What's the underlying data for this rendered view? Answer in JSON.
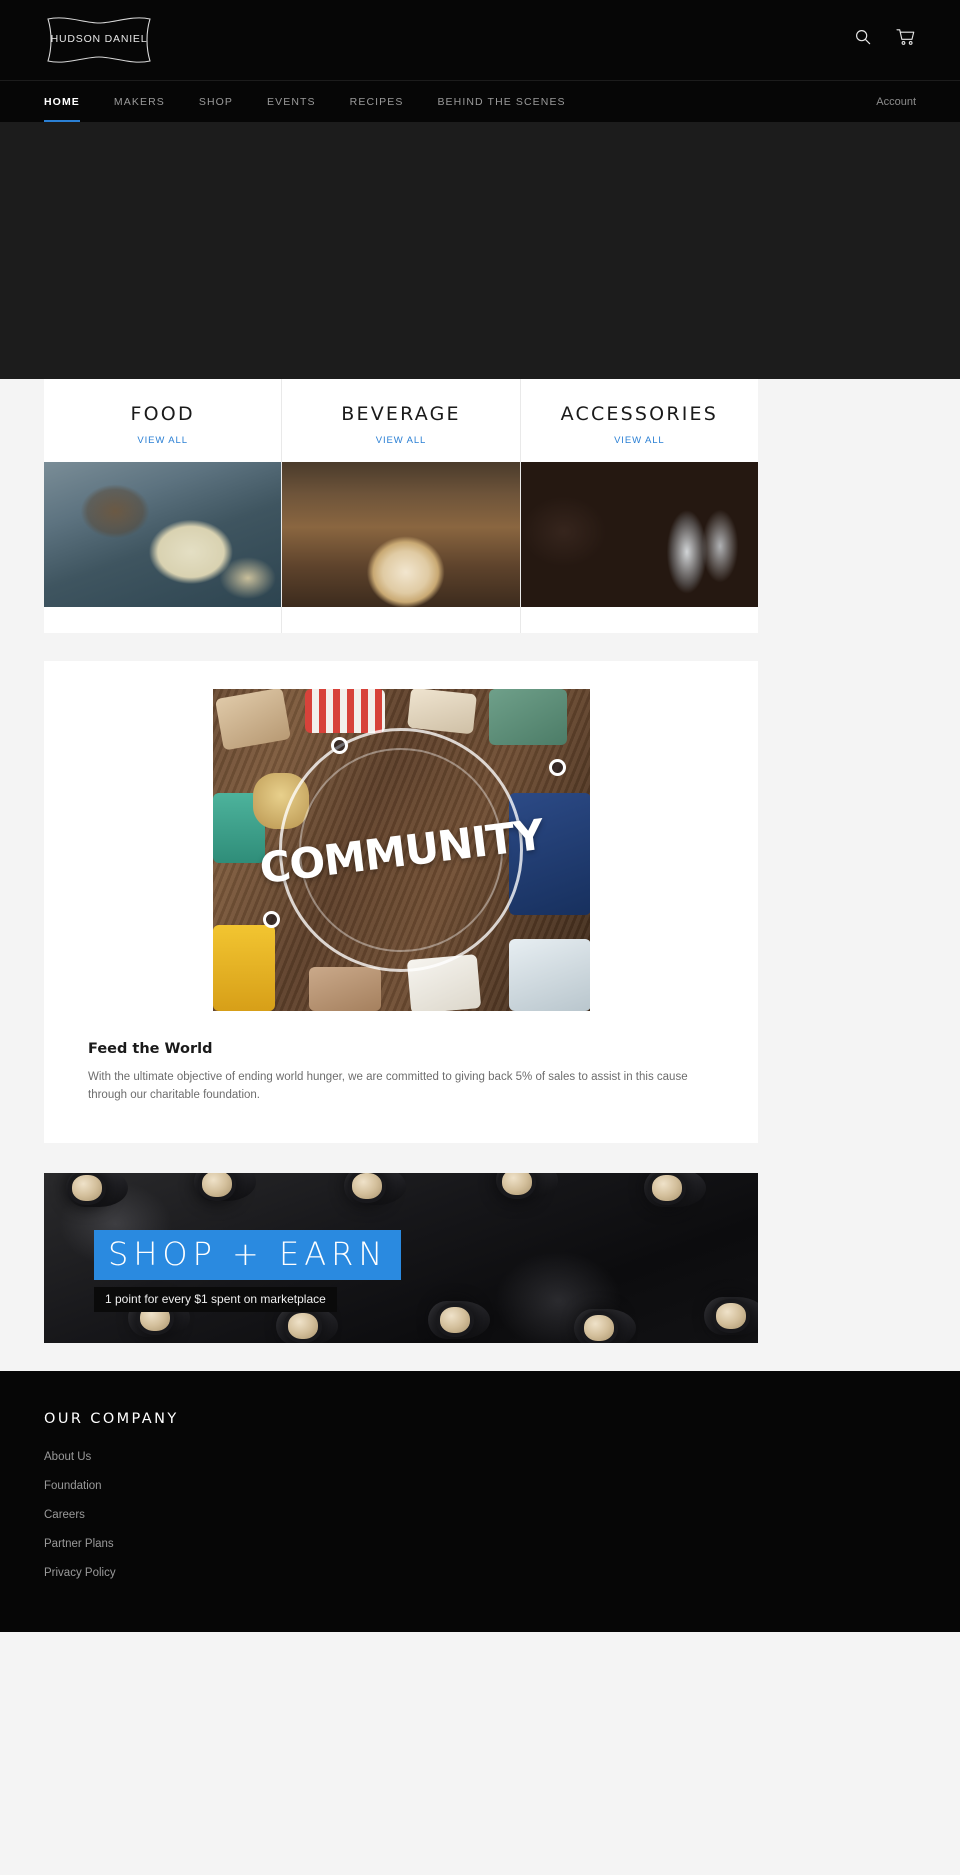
{
  "brand": {
    "name": "HUDSON DANIEL"
  },
  "header": {
    "search_icon": "search-icon",
    "cart_icon": "cart-icon"
  },
  "nav": {
    "items": [
      {
        "label": "HOME",
        "active": true
      },
      {
        "label": "MAKERS",
        "active": false
      },
      {
        "label": "SHOP",
        "active": false
      },
      {
        "label": "EVENTS",
        "active": false
      },
      {
        "label": "RECIPES",
        "active": false
      },
      {
        "label": "BEHIND THE SCENES",
        "active": false
      }
    ],
    "account_label": "Account"
  },
  "categories": [
    {
      "title": "FOOD",
      "view_all": "VIEW ALL",
      "image": "macaron-cookies-photo"
    },
    {
      "title": "BEVERAGE",
      "view_all": "VIEW ALL",
      "image": "latte-art-coffee-photo"
    },
    {
      "title": "ACCESSORIES",
      "view_all": "VIEW ALL",
      "image": "restaurant-wine-glasses-photo"
    }
  ],
  "feature": {
    "image_word": "COMMUNITY",
    "image_alt": "community-overhead-table-photo",
    "heading": "Feed the World",
    "body": "With the ultimate objective of ending world hunger, we are committed to giving back 5% of sales to assist in this cause through our charitable foundation."
  },
  "promo": {
    "headline": "SHOP + EARN",
    "subline": "1 point for every $1 spent on marketplace",
    "image_alt": "wine-bottle-corks-photo",
    "accent_color": "#2a8ae0"
  },
  "footer": {
    "column_title": "OUR COMPANY",
    "links": [
      "About Us",
      "Foundation",
      "Careers",
      "Partner Plans",
      "Privacy Policy"
    ]
  },
  "colors": {
    "accent": "#2a7fd4",
    "promo_blue": "#2a8ae0",
    "header_bg": "#060606",
    "hero_bg": "#1c1c1c",
    "page_bg": "#f4f4f4"
  }
}
